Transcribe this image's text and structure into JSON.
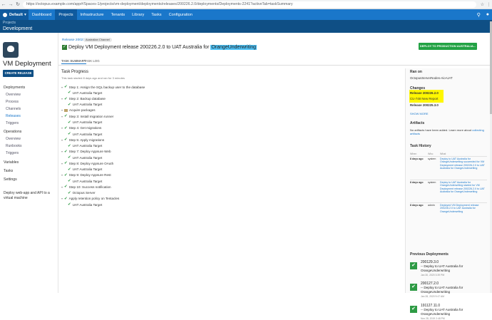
{
  "browser": {
    "url": "https://octopus.example.com/app#/Spaces-1/projects/vm-deployment/deployments/releases/200226.2.0/deployments/Deployments-2241?activeTab=taskSummary"
  },
  "nav": {
    "space": "Default",
    "items": [
      "Dashboard",
      "Projects",
      "Infrastructure",
      "Tenants",
      "Library",
      "Tasks",
      "Configuration"
    ],
    "active": "Projects"
  },
  "header": {
    "breadcrumb": "Projects",
    "title": "Development"
  },
  "sidebar": {
    "project_name": "VM Deployment",
    "create_release": "CREATE RELEASE",
    "deployments_label": "Deployments",
    "deployments_items": [
      "Overview",
      "Process",
      "Channels",
      "Releases",
      "Triggers"
    ],
    "active_item": "Releases",
    "operations_label": "Operations",
    "operations_items": [
      "Overview",
      "Runbooks",
      "Triggers"
    ],
    "variables": "Variables",
    "tasks": "Tasks",
    "settings": "Settings",
    "description": "Deploy web-app and API to a virtual machine"
  },
  "main": {
    "release_link": "Release 200226.2.0",
    "channel": "Australian Channel",
    "title_prefix": "Deploy VM Deployment release 200226.2.0 to UAT Australia for",
    "tenant": "OrangeUnderwriting",
    "deploy_button": "DEPLOY TO PRODUCTION AUSTRALIA...",
    "tabs": [
      "TASK SUMMARY",
      "TASK LOG"
    ],
    "task_title": "Task Progress",
    "task_subtitle": "This task started 8 days ago and ran for 3 minutes",
    "steps": [
      {
        "text": "Step 1: Assign the SQL backup user to the database",
        "kind": "step"
      },
      {
        "text": "UAT Australia Target",
        "kind": "target"
      },
      {
        "text": "Step 2: Backup database",
        "kind": "step"
      },
      {
        "text": "UAT Australia Target",
        "kind": "target"
      },
      {
        "text": "Acquire packages",
        "kind": "pkg"
      },
      {
        "text": "Step 3: Install migration runner",
        "kind": "step"
      },
      {
        "text": "UAT Australia Target",
        "kind": "target"
      },
      {
        "text": "Step 4: Get migrations",
        "kind": "step"
      },
      {
        "text": "UAT Australia Target",
        "kind": "target"
      },
      {
        "text": "Step 5: Apply migrations",
        "kind": "step"
      },
      {
        "text": "UAT Australia Target",
        "kind": "target"
      },
      {
        "text": "Step 7: Deploy Appsure Web",
        "kind": "step"
      },
      {
        "text": "UAT Australia Target",
        "kind": "target"
      },
      {
        "text": "Step 8: Deploy Appsure OAuth",
        "kind": "step"
      },
      {
        "text": "UAT Australia Target",
        "kind": "target"
      },
      {
        "text": "Step 9: Deploy Appsure Rest",
        "kind": "step"
      },
      {
        "text": "UAT Australia Target",
        "kind": "target"
      },
      {
        "text": "Step 10: Success notification",
        "kind": "step"
      },
      {
        "text": "Octopus Server",
        "kind": "target"
      },
      {
        "text": "Apply retention policy on Tentacles",
        "kind": "step"
      },
      {
        "text": "UAT Australia Target",
        "kind": "target"
      }
    ]
  },
  "right": {
    "ran_on_label": "Ran on",
    "ran_on_value": "OctopusServerNodes-Aio-UAT",
    "changes_label": "Changes",
    "change1_release": "Release 200226.2.0",
    "change1_note": "CU-748 New Report",
    "change2_release": "Release 200225.3.0",
    "show_more": "SHOW MORE",
    "artifacts_label": "Artifacts",
    "artifacts_text": "No artifacts have been added. Learn more about",
    "artifacts_link": "collecting artifacts",
    "history_label": "Task History",
    "history_cols": [
      "When",
      "Who",
      "What"
    ],
    "history": [
      {
        "when": "8 days ago",
        "who": "system",
        "what": "Deploy to UAT Australia for OrangeUnderwriting succeeded for VM Deployment release 200226.2.0 to UAT Australia for OrangeUnderwriting"
      },
      {
        "when": "8 days ago",
        "who": "system",
        "what": "Deploy to UAT Australia for OrangeUnderwriting started for VM Deployment release 200226.2.0 to UAT Australia for OrangeUnderwriting"
      },
      {
        "when": "8 days ago",
        "who": "admin",
        "what": "Deployed VM Deployment release 200226.2.0 to UAT Australia for OrangeUnderwriting"
      }
    ],
    "prev_label": "Previous Deployments",
    "previous": [
      {
        "version": "200129.3.0",
        "deploy": "-- Deploy to UAT Australia for OrangeUnderwriting",
        "date": "Jan 30, 2020 3:39 PM"
      },
      {
        "version": "200127.2.0",
        "deploy": "-- Deploy to UAT Australia for OrangeUnderwriting",
        "date": "Jan 28, 2020 9:47 AM"
      },
      {
        "version": "191127.11.0",
        "deploy": "-- Deploy to UAT Australia for OrangeUnderwriting",
        "date": "Nov 28, 2019 2:48 PM"
      }
    ]
  }
}
